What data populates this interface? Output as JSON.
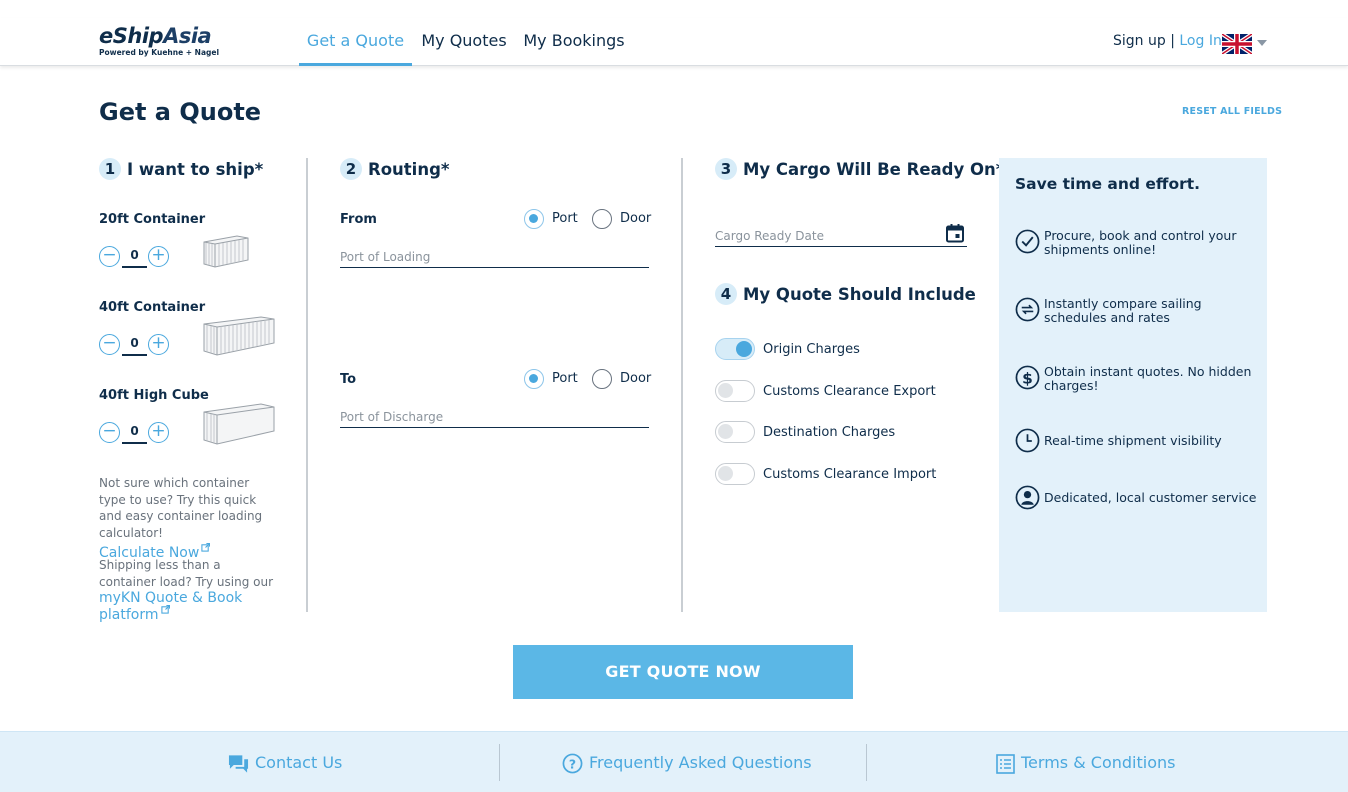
{
  "header": {
    "logo_e": "e",
    "logo_ship": "Ship",
    "logo_asia": "Asia",
    "logo_sub": "Powered by Kuehne + Nagel",
    "tabs": [
      {
        "label": "Get a Quote",
        "active": true
      },
      {
        "label": "My Quotes",
        "active": false
      },
      {
        "label": "My Bookings",
        "active": false
      }
    ],
    "signup": "Sign up",
    "separator": " | ",
    "login": "Log In",
    "language_icon": "uk-flag-icon"
  },
  "page": {
    "title": "Get a Quote",
    "reset_label": "RESET ALL FIELDS"
  },
  "ship": {
    "step": "1",
    "title": "I want to ship*",
    "containers": [
      {
        "label": "20ft Container",
        "qty": "0"
      },
      {
        "label": "40ft Container",
        "qty": "0"
      },
      {
        "label": "40ft High Cube",
        "qty": "0"
      }
    ],
    "minus": "−",
    "plus": "+",
    "note1": "Not sure which container type to use? Try this quick and easy container loading calculator!",
    "note1_link": "Calculate Now",
    "note2_pre": "Shipping less than a container load? Try using our ",
    "note2_link": "myKN Quote & Book platform"
  },
  "routing": {
    "step": "2",
    "title": "Routing*",
    "from_label": "From",
    "to_label": "To",
    "port_label": "Port",
    "door_label": "Door",
    "from_selected": "Port",
    "to_selected": "Port",
    "from_placeholder": "Port of Loading",
    "to_placeholder": "Port of Discharge"
  },
  "cargo": {
    "step": "3",
    "title": "My Cargo Will Be Ready On*",
    "date_placeholder": "Cargo Ready Date"
  },
  "include": {
    "step": "4",
    "title": "My Quote Should Include",
    "options": [
      {
        "label": "Origin Charges",
        "on": true
      },
      {
        "label": "Customs Clearance Export",
        "on": false
      },
      {
        "label": "Destination Charges",
        "on": false
      },
      {
        "label": "Customs Clearance Import",
        "on": false
      }
    ]
  },
  "benefits": {
    "title": "Save time and effort.",
    "items": [
      {
        "icon": "check-circle-icon",
        "text": "Procure, book and control your shipments online!"
      },
      {
        "icon": "compare-icon",
        "text": "Instantly compare sailing schedules and rates"
      },
      {
        "icon": "dollar-icon",
        "text": "Obtain instant quotes. No hidden charges!"
      },
      {
        "icon": "clock-icon",
        "text": "Real-time shipment visibility"
      },
      {
        "icon": "person-icon",
        "text": "Dedicated, local customer service"
      }
    ]
  },
  "cta": {
    "label": "GET QUOTE NOW"
  },
  "footer": {
    "contact": "Contact Us",
    "faq": "Frequently Asked Questions",
    "terms": "Terms & Conditions"
  },
  "colors": {
    "navy": "#0f2d4a",
    "accent": "#4aa8de",
    "button": "#5bb7e6",
    "panel": "#e3f1fa"
  }
}
